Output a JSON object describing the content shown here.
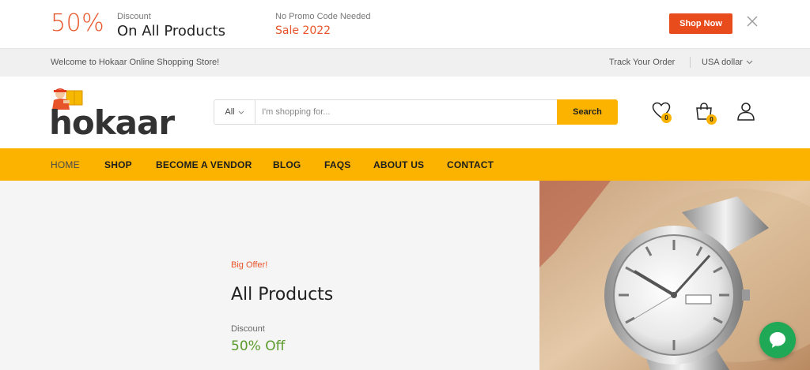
{
  "promo": {
    "percent": "50%",
    "discount_label": "Discount",
    "discount_text": "On All Products",
    "promo_label": "No Promo Code Needed",
    "promo_text": "Sale 2022",
    "shop_now": "Shop Now",
    "close_icon": "close-icon"
  },
  "topbar": {
    "welcome": "Welcome to Hokaar Online Shopping Store!",
    "track_order": "Track Your Order",
    "currency": "USA dollar"
  },
  "header": {
    "logo_text": "hokaar",
    "search": {
      "category": "All",
      "placeholder": "I'm shopping for...",
      "button": "Search"
    },
    "wishlist_count": "0",
    "cart_count": "0"
  },
  "nav": {
    "items": [
      {
        "label": "HOME"
      },
      {
        "label": "SHOP"
      },
      {
        "label": "BECOME A VENDOR"
      },
      {
        "label": "BLOG"
      },
      {
        "label": "FAQS"
      },
      {
        "label": "ABOUT US"
      },
      {
        "label": "CONTACT"
      }
    ]
  },
  "hero": {
    "tag": "Big Offer!",
    "title": "All Products",
    "discount_label": "Discount",
    "discount_value": "50% Off"
  },
  "colors": {
    "accent": "#fbb300",
    "promo_orange": "#e8542a",
    "shop_now_bg": "#e84b1c",
    "offer_green": "#5a9a2a",
    "chat_green": "#1fa855"
  }
}
